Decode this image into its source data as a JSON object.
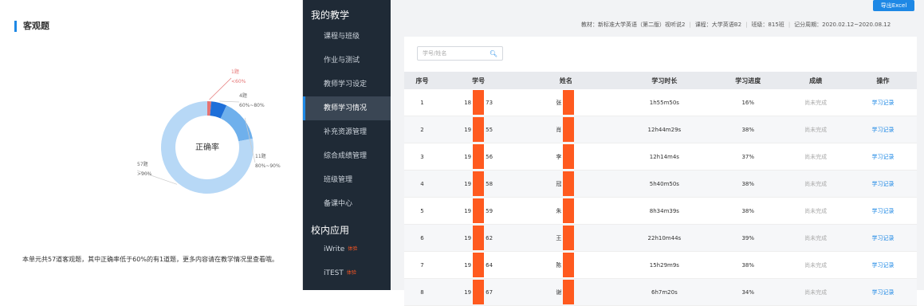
{
  "left_panel": {
    "title": "客观题",
    "donut_center": "正确率",
    "segments": [
      {
        "label": "1题",
        "range": "<60%",
        "value": 1,
        "color": "#e57373"
      },
      {
        "label": "4题",
        "range": "60%~80%",
        "value": 4,
        "color": "#1e6fd9"
      },
      {
        "label": "11题",
        "range": "80%~90%",
        "value": 11,
        "color": "#6fb0ec"
      },
      {
        "label": "57题",
        "range": ">90%",
        "value": 57,
        "color": "#b7d8f6"
      }
    ],
    "summary": "本单元共57道客观题，其中正确率低于60%的有1道题，更多内容请在教学情况里查看哦。"
  },
  "sidebar": {
    "group1": "我的教学",
    "group2": "校内应用",
    "items": [
      {
        "label": "课程与班级"
      },
      {
        "label": "作业与测试"
      },
      {
        "label": "教师学习设定"
      },
      {
        "label": "教师学习情况"
      },
      {
        "label": "补充资源管理"
      },
      {
        "label": "综合成绩管理"
      },
      {
        "label": "班级管理"
      },
      {
        "label": "备课中心"
      }
    ],
    "apps": [
      {
        "label": "iWrite",
        "badge": "体验"
      },
      {
        "label": "iTEST",
        "badge": "体验"
      }
    ]
  },
  "main": {
    "export_button": "导出Excel",
    "course_info": {
      "textbook": "教材：新标准大学英语（第二版）视听说2",
      "course": "课程：大学英语B2",
      "class": "班级：815班",
      "period": "记分周期：2020.02.12~2020.08.12"
    },
    "search_placeholder": "学号/姓名",
    "table": {
      "headers": [
        "序号",
        "学号",
        "姓名",
        "学习时长",
        "学习进度",
        "成绩",
        "操作"
      ],
      "rows": [
        {
          "no": "1",
          "id_a": "18",
          "id_b": "73",
          "name": "张",
          "duration": "1h55m50s",
          "progress": "16%",
          "score": "尚未完成",
          "action": "学习记录"
        },
        {
          "no": "2",
          "id_a": "19",
          "id_b": "55",
          "name": "肖",
          "duration": "12h44m29s",
          "progress": "38%",
          "score": "尚未完成",
          "action": "学习记录"
        },
        {
          "no": "3",
          "id_a": "19",
          "id_b": "56",
          "name": "李",
          "duration": "12h14m4s",
          "progress": "37%",
          "score": "尚未完成",
          "action": "学习记录"
        },
        {
          "no": "4",
          "id_a": "19",
          "id_b": "58",
          "name": "冠",
          "duration": "5h40m50s",
          "progress": "38%",
          "score": "尚未完成",
          "action": "学习记录"
        },
        {
          "no": "5",
          "id_a": "19",
          "id_b": "59",
          "name": "朱",
          "duration": "8h34m39s",
          "progress": "38%",
          "score": "尚未完成",
          "action": "学习记录"
        },
        {
          "no": "6",
          "id_a": "19",
          "id_b": "62",
          "name": "王",
          "duration": "22h10m44s",
          "progress": "39%",
          "score": "尚未完成",
          "action": "学习记录"
        },
        {
          "no": "7",
          "id_a": "19",
          "id_b": "64",
          "name": "陈",
          "duration": "15h29m9s",
          "progress": "38%",
          "score": "尚未完成",
          "action": "学习记录"
        },
        {
          "no": "8",
          "id_a": "19",
          "id_b": "67",
          "name": "谢",
          "duration": "6h7m20s",
          "progress": "34%",
          "score": "尚未完成",
          "action": "学习记录"
        }
      ]
    }
  }
}
